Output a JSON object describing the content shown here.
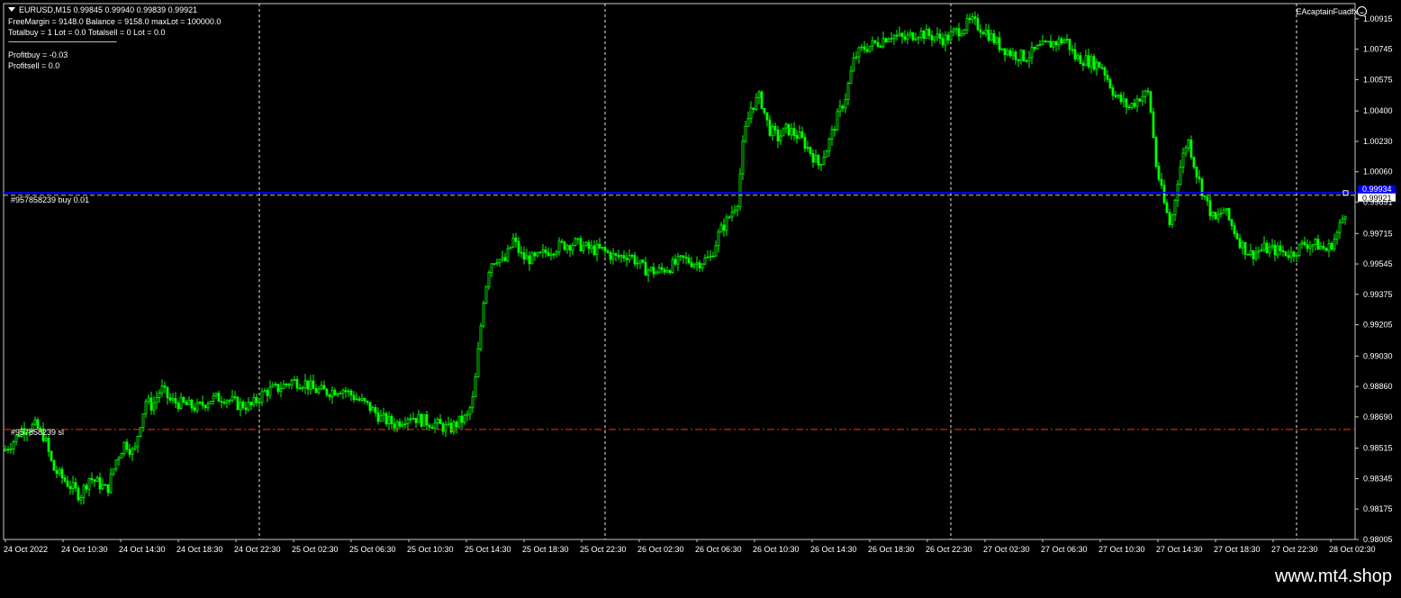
{
  "info": {
    "symbol_line": "EURUSD,M15  0.99845 0.99940 0.99839 0.99921",
    "line2": "FreeMargin = 9148.0  Balance = 9158.0  maxLot = 100000.0",
    "line3": "Totalbuy = 1  Lot = 0.0  Totalsell = 0  Lot = 0.0",
    "separator": "------------------------------------------------------------",
    "profitbuy": "Profitbuy = -0.03",
    "profitsell": "Profitsell = 0.0"
  },
  "ea_name": "EAcaptainFuadfx",
  "order_buy_label": "#957858239 buy 0.01",
  "order_sl_label": "#957858239 sl",
  "current_price_label": "0.99921",
  "order_price_label": "0.99934",
  "watermark": "www.mt4.shop",
  "colors": {
    "background": "#000000",
    "candle": "#00ff00",
    "grid": "#ffffff",
    "order_line": "#0000ff",
    "sl_line": "#ff3300",
    "bid_line": "#c0c0c0",
    "axis_text": "#ffffff"
  },
  "chart_data": {
    "type": "candlestick",
    "symbol": "EURUSD",
    "timeframe": "M15",
    "ohlc_last": {
      "open": 0.99845,
      "high": 0.9994,
      "low": 0.99839,
      "close": 0.99921
    },
    "ylim": [
      0.98005,
      1.01
    ],
    "y_ticks": [
      "1.00915",
      "1.00745",
      "1.00575",
      "1.00400",
      "1.00230",
      "1.00060",
      "0.99891",
      "0.99715",
      "0.99545",
      "0.99375",
      "0.99205",
      "0.99030",
      "0.98860",
      "0.98690",
      "0.98515",
      "0.98345",
      "0.98175",
      "0.98005"
    ],
    "x_ticks": [
      "24 Oct 2022",
      "24 Oct 10:30",
      "24 Oct 14:30",
      "24 Oct 18:30",
      "24 Oct 22:30",
      "25 Oct 02:30",
      "25 Oct 06:30",
      "25 Oct 10:30",
      "25 Oct 14:30",
      "25 Oct 18:30",
      "25 Oct 22:30",
      "26 Oct 02:30",
      "26 Oct 06:30",
      "26 Oct 10:30",
      "26 Oct 14:30",
      "26 Oct 18:30",
      "26 Oct 22:30",
      "27 Oct 02:30",
      "27 Oct 06:30",
      "27 Oct 10:30",
      "27 Oct 14:30",
      "27 Oct 18:30",
      "27 Oct 22:30",
      "28 Oct 02:30"
    ],
    "vertical_separators": [
      "24 Oct 22:30",
      "25 Oct 22:30",
      "26 Oct 22:30",
      "27 Oct 22:30"
    ],
    "order_buy_price": 0.99934,
    "stop_loss_price": 0.9862,
    "price_path": [
      [
        0,
        0.985
      ],
      [
        10,
        0.9855
      ],
      [
        20,
        0.9862
      ],
      [
        35,
        0.9864
      ],
      [
        45,
        0.9858
      ],
      [
        55,
        0.984
      ],
      [
        65,
        0.9835
      ],
      [
        75,
        0.983
      ],
      [
        85,
        0.9825
      ],
      [
        95,
        0.9835
      ],
      [
        105,
        0.9832
      ],
      [
        115,
        0.9828
      ],
      [
        125,
        0.9845
      ],
      [
        135,
        0.9855
      ],
      [
        145,
        0.9848
      ],
      [
        150,
        0.9862
      ],
      [
        158,
        0.9878
      ],
      [
        165,
        0.9875
      ],
      [
        175,
        0.9885
      ],
      [
        185,
        0.9878
      ],
      [
        200,
        0.9876
      ],
      [
        215,
        0.9874
      ],
      [
        230,
        0.9879
      ],
      [
        245,
        0.988
      ],
      [
        260,
        0.9876
      ],
      [
        275,
        0.9875
      ],
      [
        290,
        0.9883
      ],
      [
        305,
        0.9885
      ],
      [
        320,
        0.9889
      ],
      [
        335,
        0.9888
      ],
      [
        345,
        0.9884
      ],
      [
        360,
        0.9883
      ],
      [
        375,
        0.9885
      ],
      [
        390,
        0.988
      ],
      [
        405,
        0.9875
      ],
      [
        420,
        0.9868
      ],
      [
        435,
        0.9865
      ],
      [
        450,
        0.987
      ],
      [
        465,
        0.9867
      ],
      [
        480,
        0.9865
      ],
      [
        495,
        0.9862
      ],
      [
        505,
        0.9866
      ],
      [
        515,
        0.9869
      ],
      [
        522,
        0.988
      ],
      [
        528,
        0.991
      ],
      [
        533,
        0.9935
      ],
      [
        540,
        0.9955
      ],
      [
        548,
        0.9958
      ],
      [
        556,
        0.9955
      ],
      [
        566,
        0.9968
      ],
      [
        576,
        0.9958
      ],
      [
        590,
        0.9957
      ],
      [
        605,
        0.9962
      ],
      [
        620,
        0.9965
      ],
      [
        635,
        0.9966
      ],
      [
        650,
        0.9963
      ],
      [
        665,
        0.9962
      ],
      [
        680,
        0.9958
      ],
      [
        695,
        0.996
      ],
      [
        710,
        0.9952
      ],
      [
        725,
        0.995
      ],
      [
        740,
        0.9953
      ],
      [
        755,
        0.9957
      ],
      [
        770,
        0.9955
      ],
      [
        785,
        0.9958
      ],
      [
        795,
        0.9972
      ],
      [
        805,
        0.998
      ],
      [
        815,
        0.999
      ],
      [
        822,
        1.0025
      ],
      [
        830,
        1.0042
      ],
      [
        840,
        1.0048
      ],
      [
        850,
        1.003
      ],
      [
        860,
        1.0025
      ],
      [
        870,
        1.003
      ],
      [
        885,
        1.0025
      ],
      [
        895,
        1.0018
      ],
      [
        905,
        1.001
      ],
      [
        915,
        1.002
      ],
      [
        925,
        1.0035
      ],
      [
        935,
        1.0048
      ],
      [
        945,
        1.007
      ],
      [
        955,
        1.0075
      ],
      [
        970,
        1.0078
      ],
      [
        985,
        1.0083
      ],
      [
        1000,
        1.008
      ],
      [
        1015,
        1.0084
      ],
      [
        1030,
        1.0082
      ],
      [
        1045,
        1.008
      ],
      [
        1060,
        1.0085
      ],
      [
        1075,
        1.009
      ],
      [
        1090,
        1.0085
      ],
      [
        1105,
        1.0077
      ],
      [
        1120,
        1.0072
      ],
      [
        1135,
        1.007
      ],
      [
        1150,
        1.0075
      ],
      [
        1165,
        1.0078
      ],
      [
        1180,
        1.008
      ],
      [
        1190,
        1.007
      ],
      [
        1205,
        1.0068
      ],
      [
        1220,
        1.0065
      ],
      [
        1235,
        1.0048
      ],
      [
        1250,
        1.0042
      ],
      [
        1262,
        1.0048
      ],
      [
        1272,
        1.005
      ],
      [
        1280,
        1.001
      ],
      [
        1288,
        0.999
      ],
      [
        1296,
        0.9975
      ],
      [
        1305,
        1.0005
      ],
      [
        1315,
        1.0025
      ],
      [
        1325,
        1.0005
      ],
      [
        1335,
        0.999
      ],
      [
        1345,
        0.9978
      ],
      [
        1355,
        0.9985
      ],
      [
        1365,
        0.9975
      ],
      [
        1375,
        0.9965
      ],
      [
        1385,
        0.996
      ],
      [
        1400,
        0.9963
      ],
      [
        1415,
        0.9962
      ],
      [
        1430,
        0.996
      ],
      [
        1445,
        0.9966
      ],
      [
        1460,
        0.9965
      ],
      [
        1470,
        0.9962
      ],
      [
        1480,
        0.997
      ],
      [
        1490,
        0.9984
      ],
      [
        1495,
        0.9992
      ]
    ]
  }
}
